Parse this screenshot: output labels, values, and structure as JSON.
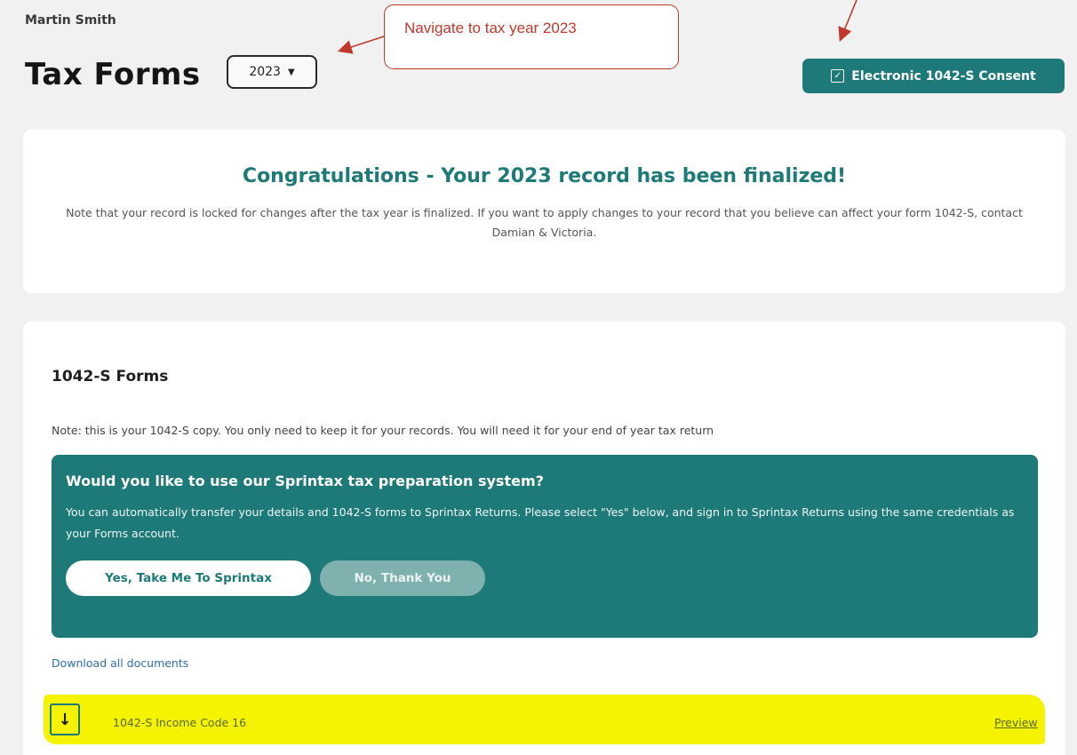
{
  "user": {
    "name": "Martin Smith"
  },
  "header": {
    "title": "Tax Forms",
    "year_selected": "2023",
    "consent_button": "Electronic 1042-S Consent"
  },
  "annotation": {
    "callout_text": "Navigate to tax year 2023",
    "color": "#c0392b"
  },
  "congrats": {
    "title": "Congratulations - Your 2023 record has been finalized!",
    "note": "Note that your record is locked for changes after the tax year is finalized. If you want to apply changes to your record that you believe can affect your form 1042-S, contact Damian & Victoria."
  },
  "forms": {
    "title": "1042-S Forms",
    "note": "Note: this is your 1042-S copy. You only need to keep it for your records. You will need it for your end of year tax return",
    "promo": {
      "title": "Would you like to use our Sprintax tax preparation system?",
      "body": "You can automatically transfer your details and 1042-S forms to Sprintax Returns. Please select \"Yes\" below, and sign in to Sprintax Returns using the same credentials as your Forms account.",
      "yes_label": "Yes, Take Me To Sprintax",
      "no_label": "No, Thank You"
    },
    "download_all": "Download all documents",
    "documents": [
      {
        "name": "1042-S Income Code 16",
        "action": "Preview"
      }
    ]
  },
  "colors": {
    "accent": "#1e7a78",
    "highlight": "#f6f300",
    "background": "#f1f1f1"
  },
  "icons": {
    "year_dropdown": "chevron-down-icon",
    "consent": "checkbox-icon",
    "document": "download-document-icon"
  }
}
